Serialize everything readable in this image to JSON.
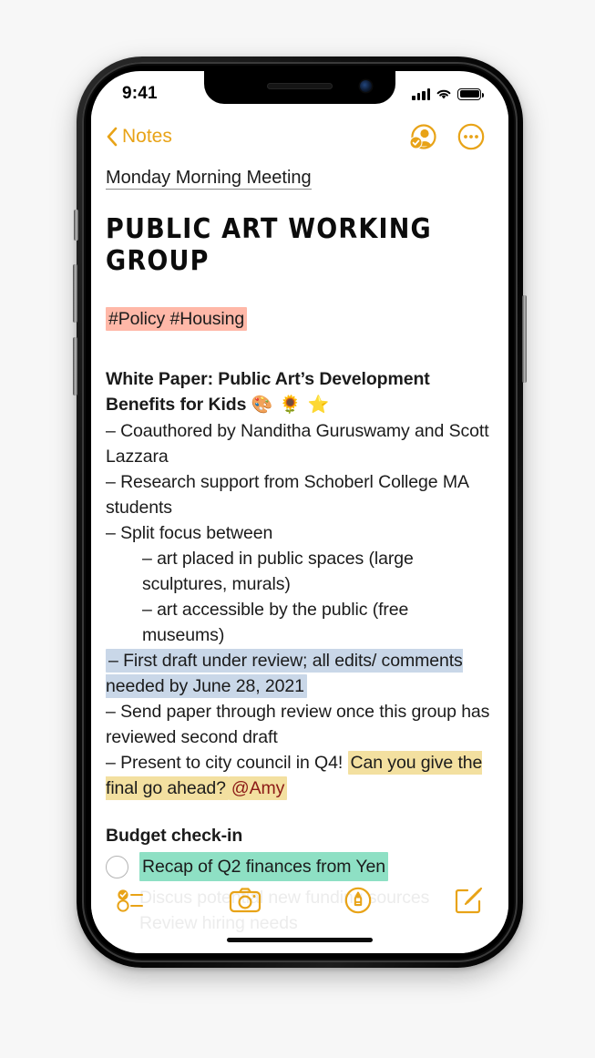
{
  "status_bar": {
    "time": "9:41",
    "signal_icon": "cellular-signal-icon",
    "wifi_icon": "wifi-icon",
    "battery_icon": "battery-full-icon"
  },
  "nav_bar": {
    "back_label": "Notes",
    "back_icon": "chevron-left-icon",
    "collaborate_icon": "person-badge-check-icon",
    "more_icon": "ellipsis-circle-icon",
    "accent_color": "#E8A317"
  },
  "note": {
    "title": "Monday Morning Meeting",
    "heading": "PUBLIC ART WORKING GROUP",
    "tags": "#Policy #Housing",
    "tags_highlight_color": "#FFB8A8",
    "section_heading_line1": "White Paper: Public Art’s Development",
    "section_heading_line2": "Benefits for Kids",
    "section_heading_emoji": "🎨 🌻 ⭐",
    "bullets": [
      "– Coauthored by Nanditha Guruswamy and Scott Lazzara",
      "– Research support from Schoberl College MA students",
      "– Split focus between"
    ],
    "sub_bullets": [
      "– art placed in public spaces (large sculptures, murals)",
      "– art accessible by the public (free museums)"
    ],
    "highlighted_blue_bullet": "– First draft under review; all edits/ comments needed by June 28, 2021",
    "blue_highlight_color": "#C9D7E8",
    "plain_bullet": "– Send paper through review once this group has reviewed second draft",
    "q4_bullet_prefix": "– Present to city council in Q4!",
    "q4_bullet_highlighted": "Can you give the final go ahead?",
    "q4_mention": "@Amy",
    "yellow_highlight_color": "#F3E0A0",
    "mention_color": "#8C1A16",
    "budget_heading": "Budget check-in",
    "checklist_item": "Recap of Q2 finances from Yen",
    "checklist_highlight_color": "#8EE0C4",
    "checkbox_icon": "unchecked-circle-icon",
    "faded_line_1": "Discus potential new funding sources",
    "faded_line_2": "Review hiring needs"
  },
  "toolbar": {
    "checklist_icon": "checklist-icon",
    "camera_icon": "camera-icon",
    "markup_icon": "markup-pen-icon",
    "compose_icon": "compose-icon",
    "accent_color": "#E8A317"
  },
  "device": {
    "home_indicator": "home-indicator",
    "notch": "notch",
    "speaker_icon": "earpiece-speaker-icon",
    "front_camera_icon": "front-camera-icon",
    "mute_switch": "mute-switch-button",
    "volume_up": "volume-up-button",
    "volume_down": "volume-down-button",
    "power": "power-button"
  }
}
